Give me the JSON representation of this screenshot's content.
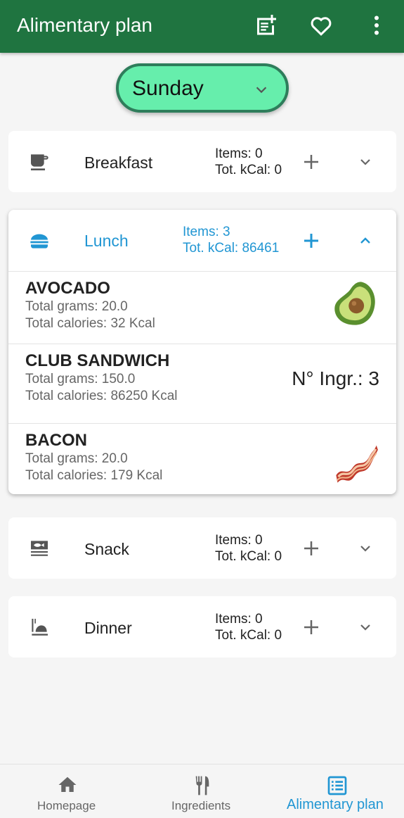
{
  "app": {
    "title": "Alimentary plan",
    "actions": [
      "note-add-icon",
      "heart-outline-icon",
      "more-vertical-icon"
    ]
  },
  "day_selector": {
    "selected": "Sunday"
  },
  "meals": [
    {
      "name": "Breakfast",
      "icon": "coffee-cup-icon",
      "items_label": "Items: 0",
      "kcal_label": "Tot. kCal: 0",
      "expanded": false
    },
    {
      "name": "Lunch",
      "icon": "burger-icon",
      "items_label": "Items: 3",
      "kcal_label": "Tot. kCal: 86461",
      "expanded": true,
      "items": [
        {
          "name": "AVOCADO",
          "grams": "Total grams: 20.0",
          "calories": "Total calories: 32 Kcal",
          "thumbnail": "avocado-icon"
        },
        {
          "name": "CLUB SANDWICH",
          "grams": "Total grams: 150.0",
          "calories": "Total calories: 86250 Kcal",
          "ingredients": "N° Ingr.: 3"
        },
        {
          "name": "BACON",
          "grams": "Total grams: 20.0",
          "calories": "Total calories: 179 Kcal",
          "thumbnail": "bacon-icon"
        }
      ]
    },
    {
      "name": "Snack",
      "icon": "snack-icon",
      "items_label": "Items: 0",
      "kcal_label": "Tot. kCal: 0",
      "expanded": false
    },
    {
      "name": "Dinner",
      "icon": "dinner-icon",
      "items_label": "Items: 0",
      "kcal_label": "Tot. kCal: 0",
      "expanded": false
    }
  ],
  "bottom_nav": [
    {
      "label": "Homepage",
      "icon": "home-icon",
      "active": false
    },
    {
      "label": "Ingredients",
      "icon": "fork-knife-icon",
      "active": false
    },
    {
      "label": "Alimentary plan",
      "icon": "list-icon",
      "active": true
    }
  ],
  "colors": {
    "appbar": "#1f7440",
    "selector": "#66eeac",
    "accent": "#2196d3"
  }
}
